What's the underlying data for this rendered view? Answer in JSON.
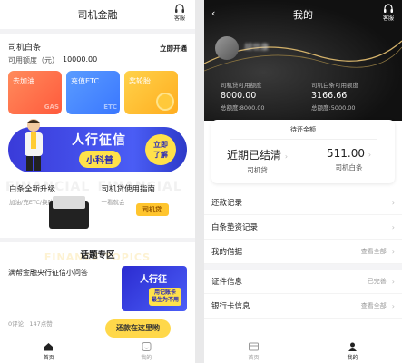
{
  "left": {
    "header": {
      "title": "司机金融",
      "support_label": "客服"
    },
    "card": {
      "name": "司机白条",
      "quota_label": "可用额度（元）",
      "quota_value": "10000.00",
      "open_link": "立即开通"
    },
    "tiles": [
      {
        "label": "去加油",
        "deco": "GAS"
      },
      {
        "label": "充值ETC",
        "deco": "ETC"
      },
      {
        "label": "奖轮胎",
        "deco": ""
      }
    ],
    "banner": {
      "title": "人行征信",
      "subtitle": "小科普",
      "button_line1": "立即",
      "button_line2": "了解"
    },
    "promos": [
      {
        "ghost": "FINANCIAL",
        "title": "白条全新升级",
        "desc": "加油/充ETC/换胎"
      },
      {
        "ghost": "FINANCIAL",
        "title": "司机贷使用指南",
        "desc": "一看就会",
        "badge": "司机贷"
      }
    ],
    "topics": {
      "heading": "话题专区",
      "ghost": "FINANCE TOPICS",
      "item_text": "满帮金融央行征信小问答",
      "thumb_title": "人行征",
      "thumb_badge_line1": "用记账卡",
      "thumb_badge_line2": "最生为不用",
      "meta_comments": "0评论",
      "meta_likes": "147点赞"
    },
    "fab": "还款在这里哟",
    "tabs": [
      {
        "label": "首页"
      },
      {
        "label": "我的"
      }
    ]
  },
  "right": {
    "header": {
      "title": "我的",
      "support_label": "客服",
      "back": "‹"
    },
    "user_name": "胡世康",
    "limits": [
      {
        "label": "司机贷可用额度",
        "value": "8000.00",
        "total": "总额度:8000.00"
      },
      {
        "label": "司机白条可用额度",
        "value": "3166.66",
        "total": "总额度:5000.00"
      }
    ],
    "due": {
      "label": "待还金额",
      "cols": [
        {
          "value": "近期已结清",
          "sub": "司机贷"
        },
        {
          "value": "511.00",
          "sub": "司机白条"
        }
      ]
    },
    "menu": [
      {
        "label": "还款记录",
        "extra": ""
      },
      {
        "label": "白条垫资记录",
        "extra": ""
      },
      {
        "label": "我的借据",
        "extra": "查看全部"
      },
      {
        "label": "证件信息",
        "extra": "已完善"
      },
      {
        "label": "银行卡信息",
        "extra": "查看全部"
      }
    ],
    "tabs": [
      {
        "label": "首页"
      },
      {
        "label": "我的"
      }
    ]
  }
}
